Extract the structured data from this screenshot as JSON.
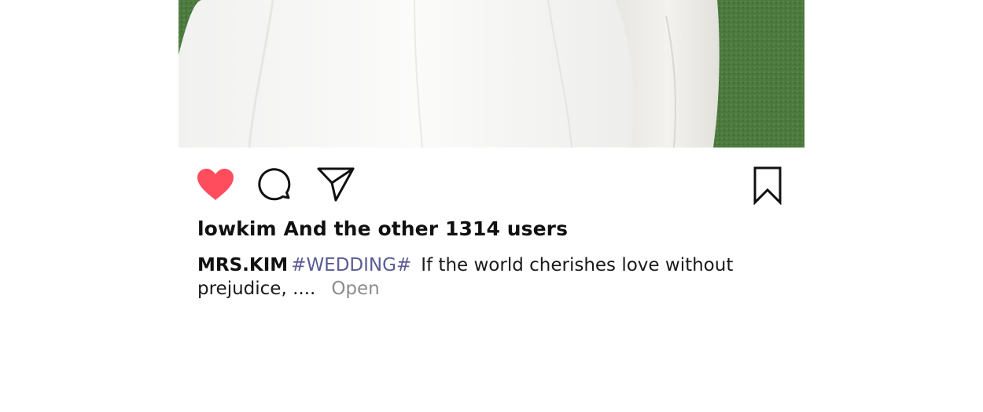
{
  "post": {
    "likes_text": "lowkim And the other 1314 users",
    "caption": {
      "author": "MRS.KIM",
      "hashtag": "#WEDDING#",
      "text": "If the world cherishes love without prejudice, ....",
      "more_label": "Open"
    }
  },
  "actions": {
    "like_icon": "heart-filled-icon",
    "comment_icon": "comment-bubble-icon",
    "share_icon": "paper-plane-icon",
    "save_icon": "bookmark-icon"
  },
  "colors": {
    "like_active": "#ff4d5e",
    "hashtag": "#5a5c94",
    "muted": "#8c8c8c",
    "text": "#111111"
  }
}
